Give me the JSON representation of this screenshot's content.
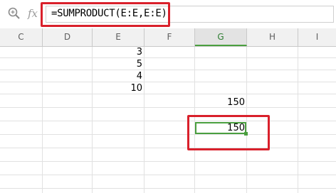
{
  "formula_bar": {
    "fx_label": "fx",
    "formula": "=SUMPRODUCT(E:E,E:E)",
    "zoom_icon": "magnifier-icon"
  },
  "columns": [
    {
      "letter": "C"
    },
    {
      "letter": "D"
    },
    {
      "letter": "E"
    },
    {
      "letter": "F"
    },
    {
      "letter": "G",
      "active": true
    },
    {
      "letter": "H"
    },
    {
      "letter": "I"
    }
  ],
  "cells": {
    "e1": "3",
    "e2": "5",
    "e3": "4",
    "e4": "10",
    "g5": "150",
    "g7": "150"
  },
  "colors": {
    "highlight": "#d9202b",
    "selection": "#4a9f3f",
    "header_bg": "#f1f1f1"
  }
}
